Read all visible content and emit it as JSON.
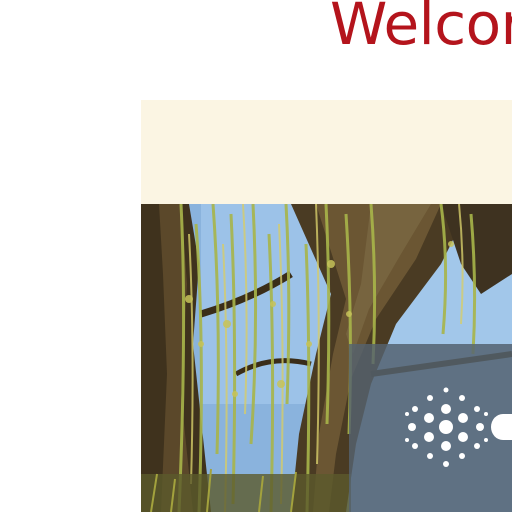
{
  "header": {
    "welcome_text": "Welcor"
  },
  "hero": {
    "image_subject": "willow-tree-photo",
    "overlay_logo": "dotted-circle-logo-icon"
  },
  "colors": {
    "heading": "#b4141c",
    "banner_background": "#fbf5e3",
    "overlay_panel": "#56636f",
    "sky": "#8ab3dd"
  }
}
